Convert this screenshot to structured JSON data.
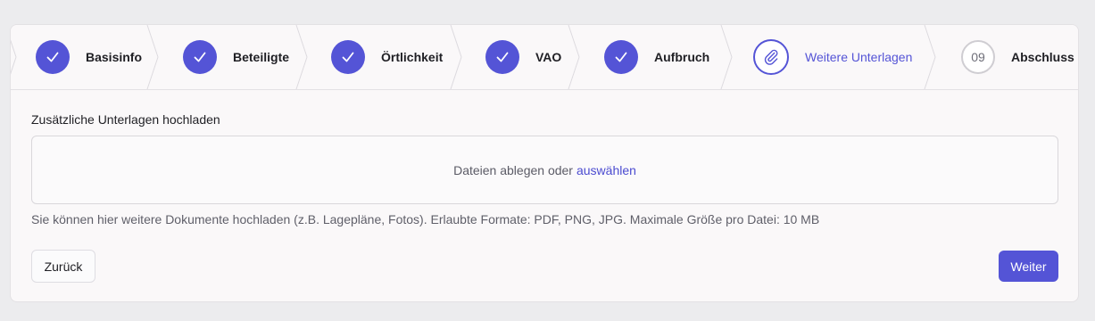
{
  "stepper": {
    "steps": [
      {
        "label": "Basisinfo",
        "state": "done",
        "icon": "check-icon"
      },
      {
        "label": "Beteiligte",
        "state": "done",
        "icon": "check-icon"
      },
      {
        "label": "Örtlichkeit",
        "state": "done",
        "icon": "check-icon"
      },
      {
        "label": "VAO",
        "state": "done",
        "icon": "check-icon"
      },
      {
        "label": "Aufbruch",
        "state": "done",
        "icon": "check-icon"
      },
      {
        "label": "Weitere Unterlagen",
        "state": "current",
        "icon": "paperclip-icon"
      },
      {
        "label": "Abschluss",
        "state": "todo",
        "number": "09"
      }
    ]
  },
  "upload": {
    "title": "Zusätzliche Unterlagen hochladen",
    "dropzone_text": "Dateien ablegen oder",
    "dropzone_link": "auswählen",
    "hint": "Sie können hier weitere Dokumente hochladen (z.B. Lagepläne, Fotos). Erlaubte Formate: PDF, PNG, JPG. Maximale Größe pro Datei: 10 MB"
  },
  "actions": {
    "back_label": "Zurück",
    "next_label": "Weiter"
  },
  "colors": {
    "accent": "#5454d6",
    "background": "#ececee",
    "card": "#faf8f9"
  }
}
